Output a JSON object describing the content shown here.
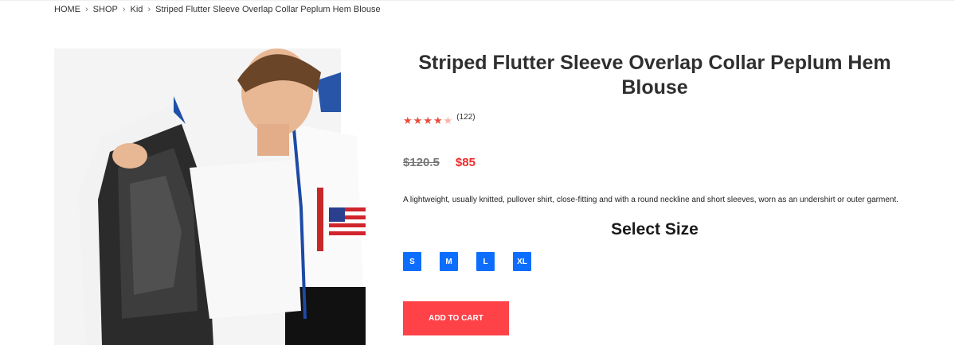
{
  "breadcrumb": {
    "items": [
      "HOME",
      "SHOP",
      "Kid"
    ],
    "current": "Striped Flutter Sleeve Overlap Collar Peplum Hem Blouse"
  },
  "product": {
    "title": "Striped Flutter Sleeve Overlap Collar Peplum Hem Blouse",
    "rating": 4,
    "rating_max": 5,
    "review_count": "(122)",
    "old_price": "$120.5",
    "new_price": "$85",
    "description": "A lightweight, usually knitted, pullover shirt, close-fitting and with a round neckline and short sleeves, worn as an undershirt or outer garment.",
    "flag_label": "",
    "image_icon": "product-photo"
  },
  "size_selector": {
    "heading": "Select Size",
    "options": [
      "S",
      "M",
      "L",
      "XL"
    ]
  },
  "cart": {
    "add_label": "ADD TO CART"
  },
  "colors": {
    "star": "#e74c3c",
    "price": "#ef2b2b",
    "size_button": "#0d6efd",
    "cart_button": "#ff4148"
  }
}
